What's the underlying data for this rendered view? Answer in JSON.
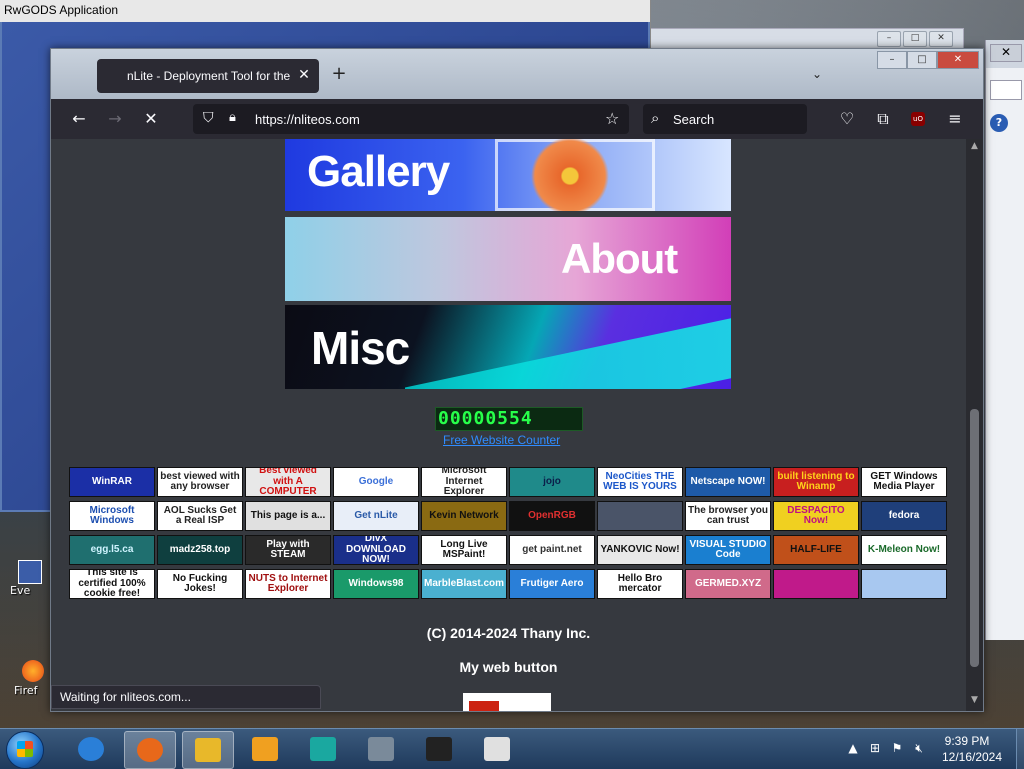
{
  "desktop": {
    "icons": [
      {
        "label": "Eve"
      },
      {
        "label": "Firef"
      }
    ]
  },
  "back_window": {
    "title": "RwGODS Application"
  },
  "browser": {
    "tab_title": "nLite - Deployment Tool for the",
    "url": "https://nliteos.com",
    "search_placeholder": "Search",
    "status": "Waiting for nliteos.com..."
  },
  "page": {
    "banners": [
      {
        "label": "Gallery"
      },
      {
        "label": "About"
      },
      {
        "label": "Misc"
      }
    ],
    "counter": "00000554",
    "counter_link": "Free Website Counter",
    "web_buttons": [
      {
        "text": "WinRAR",
        "bg": "#1b2fa6",
        "fg": "#ffffff"
      },
      {
        "text": "best viewed with any browser",
        "bg": "#ffffff",
        "fg": "#222222"
      },
      {
        "text": "Best viewed with A COMPUTER",
        "bg": "#e8e8e8",
        "fg": "#d01010"
      },
      {
        "text": "Google",
        "bg": "#ffffff",
        "fg": "#3a6fd8"
      },
      {
        "text": "Microsoft Internet Explorer",
        "bg": "#ffffff",
        "fg": "#222222"
      },
      {
        "text": "jojo",
        "bg": "#1f8a8a",
        "fg": "#0b1f4a"
      },
      {
        "text": "NeoCities THE WEB IS YOURS",
        "bg": "#ffffff",
        "fg": "#1c57c9"
      },
      {
        "text": "Netscape NOW!",
        "bg": "#1e5aa8",
        "fg": "#ffffff"
      },
      {
        "text": "built listening to Winamp",
        "bg": "#c81f1f",
        "fg": "#ffd21a"
      },
      {
        "text": "GET Windows Media Player",
        "bg": "#ffffff",
        "fg": "#111111"
      },
      {
        "text": "Microsoft Windows",
        "bg": "#ffffff",
        "fg": "#1d4fb0"
      },
      {
        "text": "AOL Sucks Get a Real ISP",
        "bg": "#ffffff",
        "fg": "#222222"
      },
      {
        "text": "This page is a...",
        "bg": "#e0e0e0",
        "fg": "#111111"
      },
      {
        "text": "Get nLite",
        "bg": "#e8eef8",
        "fg": "#2a5aa8"
      },
      {
        "text": "Kevin Network",
        "bg": "#8a6a12",
        "fg": "#111111"
      },
      {
        "text": "OpenRGB",
        "bg": "#111111",
        "fg": "#e03030"
      },
      {
        "text": "",
        "bg": "#4a5468",
        "fg": "#ffffff"
      },
      {
        "text": "The browser you can trust",
        "bg": "#ffffff",
        "fg": "#222222"
      },
      {
        "text": "DESPACITO Now!",
        "bg": "#f0d020",
        "fg": "#c01080"
      },
      {
        "text": "fedora",
        "bg": "#1f3f7a",
        "fg": "#ffffff"
      },
      {
        "text": "egg.l5.ca",
        "bg": "#1f6f6f",
        "fg": "#cff4ff"
      },
      {
        "text": "madz258.top",
        "bg": "#0f3f3f",
        "fg": "#ffffff"
      },
      {
        "text": "Play with STEAM",
        "bg": "#2a2a2a",
        "fg": "#ffffff"
      },
      {
        "text": "DivX DOWNLOAD NOW!",
        "bg": "#1a2f8a",
        "fg": "#ffffff"
      },
      {
        "text": "Long Live MSPaint!",
        "bg": "#ffffff",
        "fg": "#111111"
      },
      {
        "text": "get paint.net",
        "bg": "#ffffff",
        "fg": "#333333"
      },
      {
        "text": "YANKOVIC Now!",
        "bg": "#e8e8e8",
        "fg": "#111111"
      },
      {
        "text": "VISUAL STUDIO Code",
        "bg": "#1a7fd0",
        "fg": "#ffffff"
      },
      {
        "text": "HALF-LIFE",
        "bg": "#c0501a",
        "fg": "#111111"
      },
      {
        "text": "K-Meleon Now!",
        "bg": "#ffffff",
        "fg": "#1a6a2a"
      },
      {
        "text": "This site is certified 100% cookie free!",
        "bg": "#ffffff",
        "fg": "#111111"
      },
      {
        "text": "No Fucking Jokes!",
        "bg": "#ffffff",
        "fg": "#111111"
      },
      {
        "text": "NUTS to Internet Explorer",
        "bg": "#ffffff",
        "fg": "#a01010"
      },
      {
        "text": "Windows98",
        "bg": "#1a9a6a",
        "fg": "#ffffff"
      },
      {
        "text": "MarbleBlast.com",
        "bg": "#4ab0d0",
        "fg": "#ffffff"
      },
      {
        "text": "Frutiger Aero",
        "bg": "#2a7fd8",
        "fg": "#ffffff"
      },
      {
        "text": "Hello Bro mercator",
        "bg": "#ffffff",
        "fg": "#111111"
      },
      {
        "text": "GERMED.XYZ",
        "bg": "#d06a8a",
        "fg": "#ffffff"
      },
      {
        "text": "",
        "bg": "#c01a8a",
        "fg": "#ffffff"
      },
      {
        "text": "",
        "bg": "#a8c8f0",
        "fg": "#ffffff"
      }
    ],
    "copyright": "(C) 2014-2024 Thany Inc.",
    "my_web_button": "My web button"
  },
  "taskbar": {
    "time": "9:39 PM",
    "date": "12/16/2024",
    "apps": [
      {
        "name": "internet-explorer",
        "color": "#2a7fd8"
      },
      {
        "name": "firefox",
        "color": "#e8681a"
      },
      {
        "name": "file-explorer",
        "color": "#e8b82a"
      },
      {
        "name": "media-player",
        "color": "#f0a020"
      },
      {
        "name": "app-teal",
        "color": "#1aa8a0"
      },
      {
        "name": "computer-monitor",
        "color": "#7a8a9a"
      },
      {
        "name": "7z",
        "color": "#222222"
      },
      {
        "name": "document",
        "color": "#e0e0e0"
      }
    ]
  }
}
